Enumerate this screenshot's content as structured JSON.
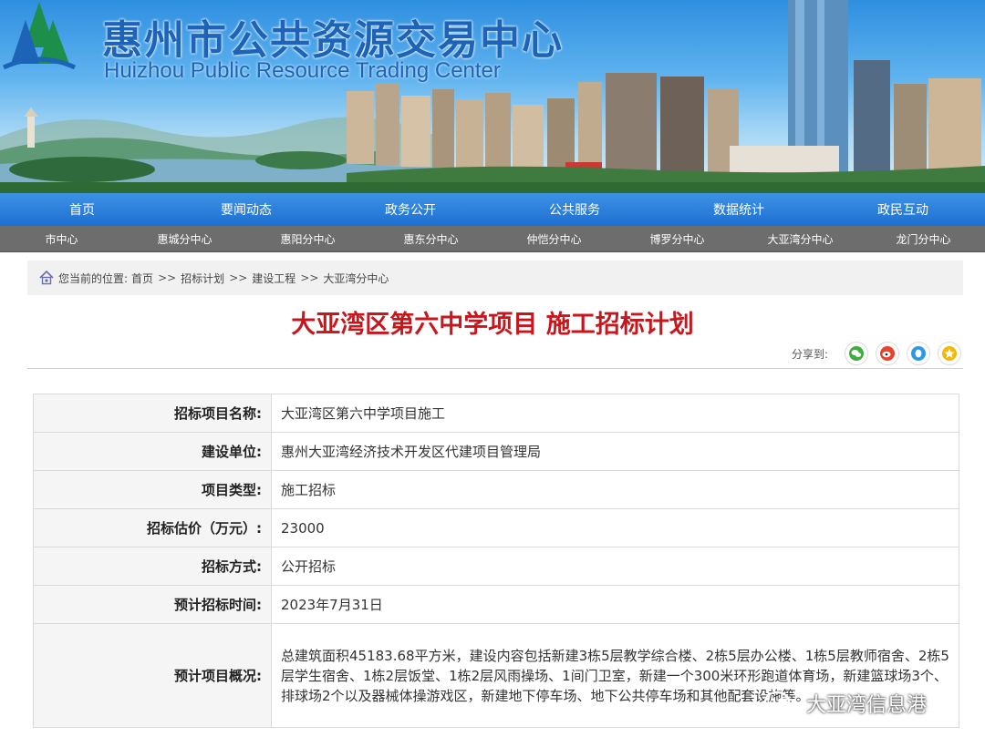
{
  "header": {
    "title_cn": "惠州市公共资源交易中心",
    "title_en": "Huizhou Public Resource Trading Center"
  },
  "nav_main": [
    "首页",
    "要闻动态",
    "政务公开",
    "公共服务",
    "数据统计",
    "政民互动"
  ],
  "nav_sub": [
    "市中心",
    "惠城分中心",
    "惠阳分中心",
    "惠东分中心",
    "仲恺分中心",
    "博罗分中心",
    "大亚湾分中心",
    "龙门分中心"
  ],
  "breadcrumb": {
    "label": "您当前的位置:",
    "items": [
      "首页",
      "招标计划",
      "建设工程",
      "大亚湾分中心"
    ],
    "separator": ">>"
  },
  "page_title": "大亚湾区第六中学项目 施工招标计划",
  "share": {
    "label": "分享到:",
    "icons": [
      "wechat-icon",
      "weibo-icon",
      "qq-icon",
      "qzone-icon"
    ]
  },
  "table": [
    {
      "key": "招标项目名称:",
      "value": "大亚湾区第六中学项目施工"
    },
    {
      "key": "建设单位:",
      "value": "惠州大亚湾经济技术开发区代建项目管理局"
    },
    {
      "key": "项目类型:",
      "value": "施工招标"
    },
    {
      "key": "招标估价（万元）:",
      "value": "23000"
    },
    {
      "key": "招标方式:",
      "value": "公开招标"
    },
    {
      "key": "预计招标时间:",
      "value": "2023年7月31日"
    },
    {
      "key": "预计项目概况:",
      "value": "总建筑面积45183.68平方米，建设内容包括新建3栋5层教学综合楼、2栋5层办公楼、1栋5层教师宿舍、2栋5层学生宿舍、1栋2层饭堂、1栋2层风雨操场、1间门卫室，新建一个300米环形跑道体育场，新建篮球场3个、排球场2个以及器械体操游戏区，新建地下停车场、地下公共停车场和其他配套设施等。"
    }
  ],
  "watermark": "大亚湾信息港",
  "colors": {
    "title_red": "#c8161d",
    "nav_blue": "#1e6fcf",
    "sub_nav_gray": "#6d6d6d",
    "brand_blue": "#1d63b8"
  }
}
